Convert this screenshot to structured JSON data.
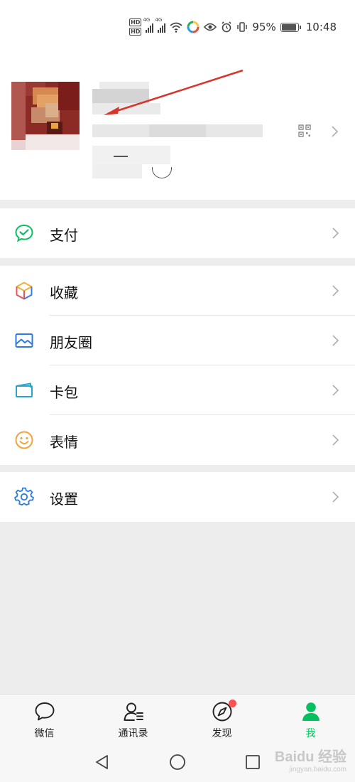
{
  "status_bar": {
    "hd_labels": [
      "HD",
      "HD"
    ],
    "net_labels": [
      "4G",
      "4G"
    ],
    "battery": "95%",
    "time": "10:48"
  },
  "menu": {
    "pay": "支付",
    "favorites": "收藏",
    "moments": "朋友圈",
    "cards": "卡包",
    "stickers": "表情",
    "settings": "设置"
  },
  "tabs": [
    {
      "label": "微信",
      "icon": "chat-bubble-icon"
    },
    {
      "label": "通讯录",
      "icon": "contacts-icon"
    },
    {
      "label": "发现",
      "icon": "compass-icon"
    },
    {
      "label": "我",
      "icon": "person-icon"
    }
  ],
  "active_tab": 3,
  "watermark": {
    "logo": "Baidu 经验",
    "url": "jingyan.baidu.com"
  },
  "colors": {
    "accent": "#07c160",
    "badge": "#fa5151",
    "annotation_arrow": "#d9342b"
  }
}
